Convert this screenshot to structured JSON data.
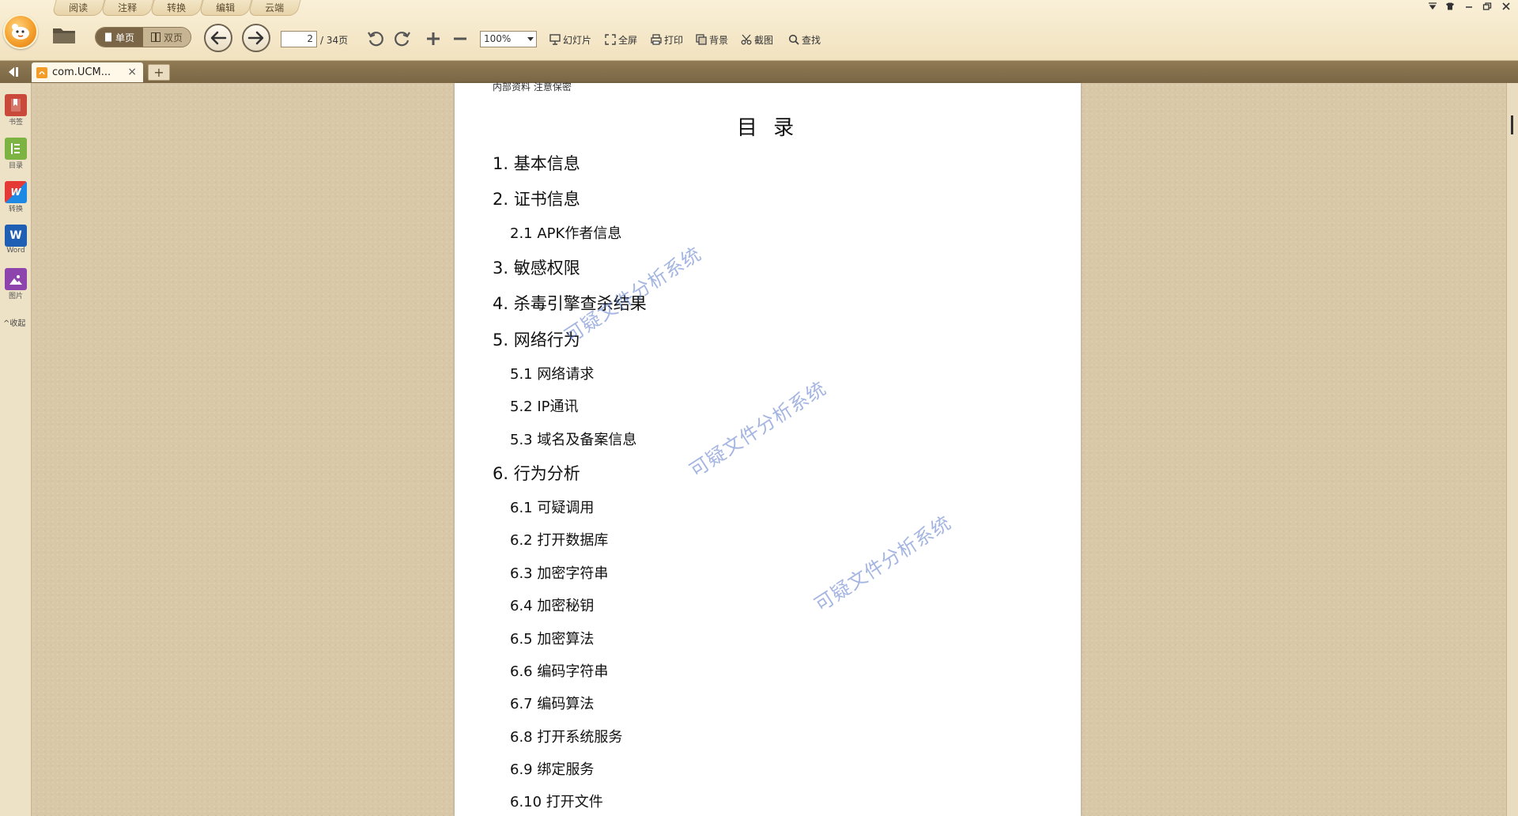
{
  "menu_tabs": [
    "阅读",
    "注释",
    "转换",
    "编辑",
    "云端"
  ],
  "toolbar": {
    "view_single": "单页",
    "view_double": "双页",
    "page_current": "2",
    "page_total": "/ 34页",
    "zoom": "100%",
    "slideshow": "幻灯片",
    "fullscreen": "全屏",
    "print": "打印",
    "background": "背景",
    "screenshot": "截图",
    "find": "查找"
  },
  "tabs": {
    "active_title": "com.UCM...",
    "close": "×",
    "new_tab": "+"
  },
  "sidebar": {
    "items": [
      {
        "label": "书签",
        "icon": "bookmark-icon",
        "color": "#c0392b"
      },
      {
        "label": "目录",
        "icon": "toc-icon",
        "color": "#7cb342"
      },
      {
        "label": "转换",
        "icon": "convert-icon",
        "color": "#e53935"
      },
      {
        "label": "Word",
        "icon": "word-icon",
        "color": "#1e5fb4"
      },
      {
        "label": "图片",
        "icon": "image-icon",
        "color": "#8e44ad"
      }
    ],
    "collapse": "^收起"
  },
  "document": {
    "header_note": "内部资料 注意保密",
    "title": "目 录",
    "toc": [
      {
        "level": 1,
        "text": "1. 基本信息"
      },
      {
        "level": 1,
        "text": "2. 证书信息"
      },
      {
        "level": 2,
        "text": "2.1 APK作者信息"
      },
      {
        "level": 1,
        "text": "3. 敏感权限"
      },
      {
        "level": 1,
        "text": "4. 杀毒引擎查杀结果"
      },
      {
        "level": 1,
        "text": "5. 网络行为"
      },
      {
        "level": 2,
        "text": "5.1 网络请求"
      },
      {
        "level": 2,
        "text": "5.2 IP通讯"
      },
      {
        "level": 2,
        "text": "5.3 域名及备案信息"
      },
      {
        "level": 1,
        "text": "6. 行为分析"
      },
      {
        "level": 2,
        "text": "6.1 可疑调用"
      },
      {
        "level": 2,
        "text": "6.2 打开数据库"
      },
      {
        "level": 2,
        "text": "6.3 加密字符串"
      },
      {
        "level": 2,
        "text": "6.4 加密秘钥"
      },
      {
        "level": 2,
        "text": "6.5 加密算法"
      },
      {
        "level": 2,
        "text": "6.6 编码字符串"
      },
      {
        "level": 2,
        "text": "6.7 编码算法"
      },
      {
        "level": 2,
        "text": "6.8 打开系统服务"
      },
      {
        "level": 2,
        "text": "6.9 绑定服务"
      },
      {
        "level": 2,
        "text": "6.10 打开文件"
      }
    ],
    "watermark": "可疑文件分析系统"
  }
}
